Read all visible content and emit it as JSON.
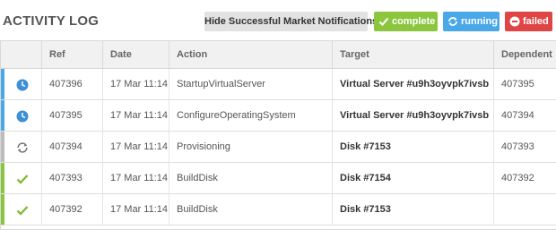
{
  "header": {
    "title": "ACTIVITY LOG",
    "hide_button": "Hide Successful Market Notifications",
    "filters": {
      "complete": "complete",
      "running": "running",
      "failed": "failed"
    }
  },
  "colors": {
    "complete": "#8cc63f",
    "running": "#4aa8e8",
    "failed": "#e04545",
    "provisioning": "#bdbdbd"
  },
  "columns": {
    "status": "",
    "ref": "Ref",
    "date": "Date",
    "action": "Action",
    "target": "Target",
    "dependent": "Dependent"
  },
  "rows": [
    {
      "status_icon": "clock-icon",
      "ref": "407396",
      "date": "17 Mar 11:14",
      "action": "StartupVirtualServer",
      "target": "Virtual Server #u9h3oyvpk7ivsb",
      "dependent": "407395"
    },
    {
      "status_icon": "clock-icon",
      "ref": "407395",
      "date": "17 Mar 11:14",
      "action": "ConfigureOperatingSystem",
      "target": "Virtual Server #u9h3oyvpk7ivsb",
      "dependent": "407394"
    },
    {
      "status_icon": "refresh-icon",
      "ref": "407394",
      "date": "17 Mar 11:14",
      "action": "Provisioning",
      "target": "Disk #7153",
      "dependent": "407393"
    },
    {
      "status_icon": "check-icon",
      "ref": "407393",
      "date": "17 Mar 11:14",
      "action": "BuildDisk",
      "target": "Disk #7154",
      "dependent": "407392"
    },
    {
      "status_icon": "check-icon",
      "ref": "407392",
      "date": "17 Mar 11:14",
      "action": "BuildDisk",
      "target": "Disk #7153",
      "dependent": ""
    }
  ]
}
